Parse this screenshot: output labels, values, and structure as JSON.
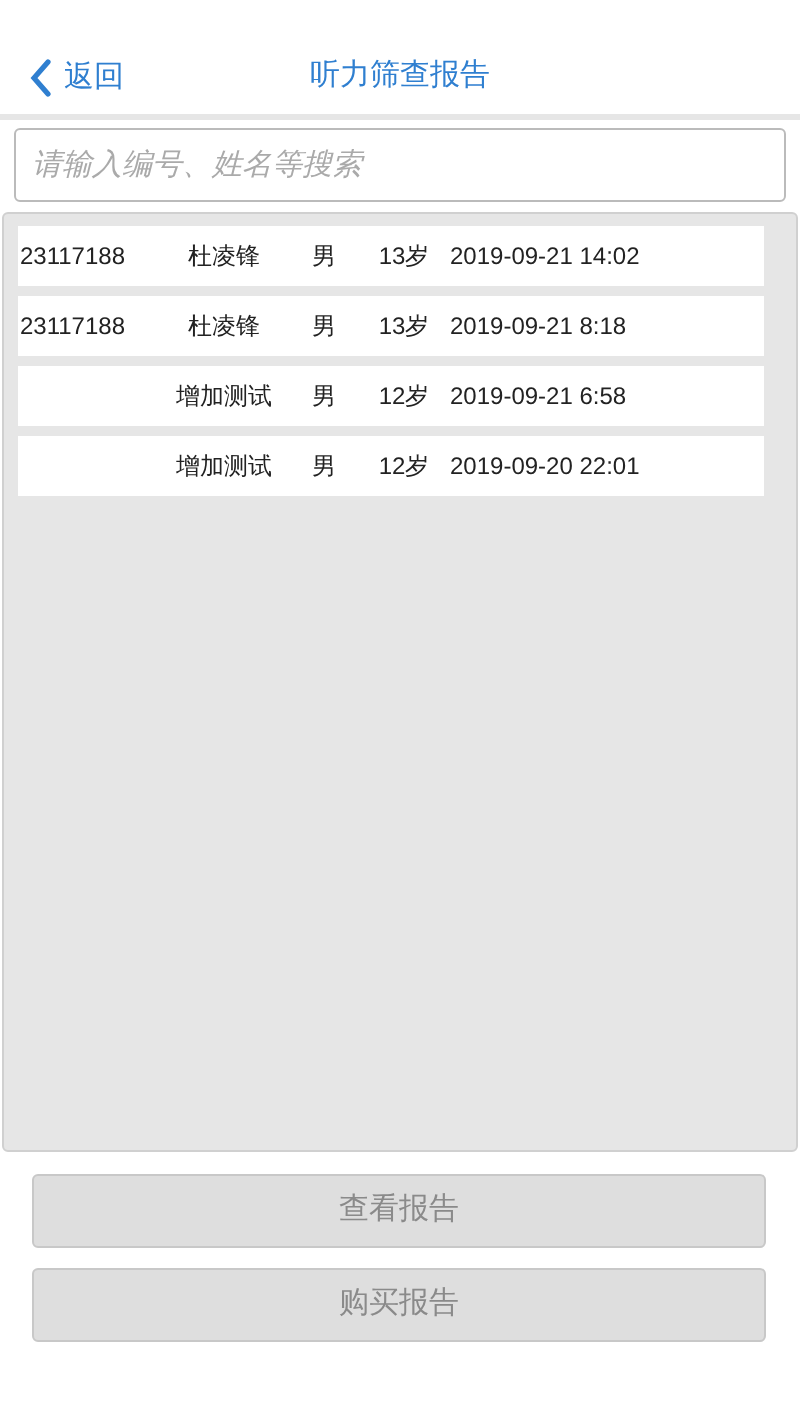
{
  "header": {
    "back": "返回",
    "title": "听力筛查报告"
  },
  "search": {
    "placeholder": "请输入编号、姓名等搜索"
  },
  "records": [
    {
      "id": "23117188",
      "name": "杜凌锋",
      "gender": "男",
      "age": "13岁",
      "time": "2019-09-21 14:02",
      "selected": false
    },
    {
      "id": "23117188",
      "name": "杜凌锋",
      "gender": "男",
      "age": "13岁",
      "time": "2019-09-21 8:18",
      "selected": false
    },
    {
      "name": "增加测试",
      "gender": "男",
      "age": "12岁",
      "time": "2019-09-21 6:58",
      "selected": false
    },
    {
      "name": "增加测试",
      "gender": "男",
      "age": "12岁",
      "time": "2019-09-20 22:01",
      "selected": false
    }
  ],
  "buttons": [
    {
      "label": "查看报告",
      "disabled": true
    },
    {
      "label": "购买报告",
      "disabled": true
    }
  ]
}
